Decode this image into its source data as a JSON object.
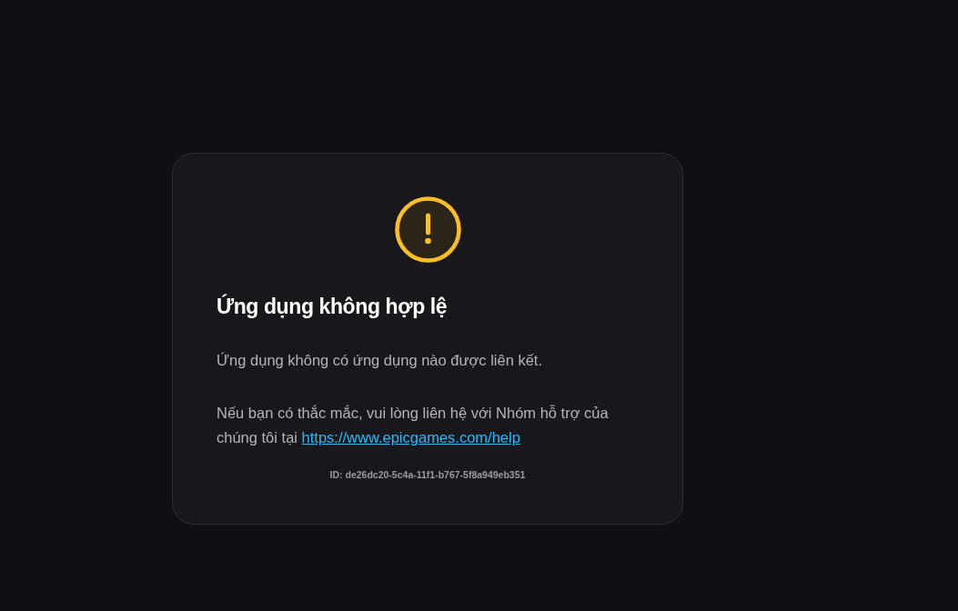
{
  "error_card": {
    "title": "Ứng dụng không hợp lệ",
    "message": "Ứng dụng không có ứng dụng nào được liên kết.",
    "help": {
      "text": "Nếu bạn có thắc mắc, vui lòng liên hệ với Nhóm hỗ trợ của chúng tôi tại",
      "link": "https://www.epicgames.com/help"
    },
    "error_id": "ID: de26dc20-5c4a-11f1-b767-5f8a949eb351"
  }
}
